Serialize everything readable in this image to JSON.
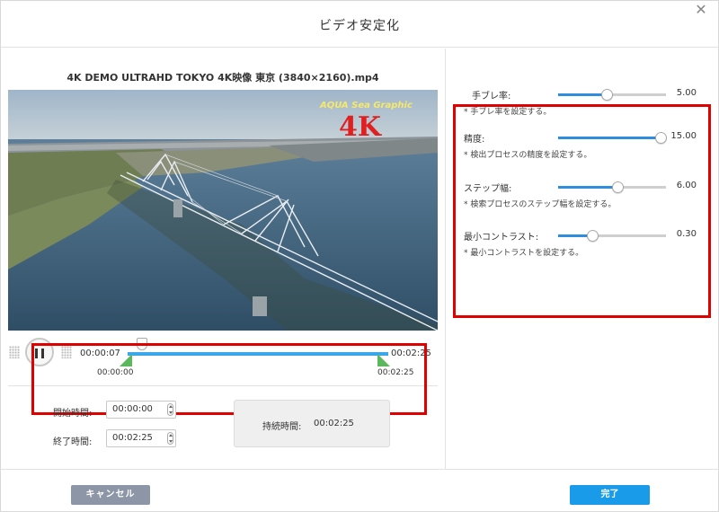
{
  "window": {
    "title": "ビデオ安定化"
  },
  "video": {
    "filename": "4K DEMO ULTRAHD TOKYO 4K映像 東京 (3840×2160).mp4",
    "watermark": "AQUA Sea Graphic",
    "badge": "4K"
  },
  "player": {
    "current_time": "00:00:07",
    "end_time_top": "00:02:25",
    "trim_start_label": "00:00:00",
    "trim_end_label": "00:02:25"
  },
  "trim": {
    "start_label": "開始時間:",
    "start_value": "00:00:00",
    "end_label": "終了時間:",
    "end_value": "00:02:25",
    "duration_label": "持続時間:",
    "duration_value": "00:02:25"
  },
  "settings": [
    {
      "label": "手ブレ率:",
      "value": "5.00",
      "level": 0.45,
      "description": "* 手ブレ率を設定する。"
    },
    {
      "label": "精度:",
      "value": "15.00",
      "level": 0.95,
      "description": "* 検出プロセスの精度を設定する。"
    },
    {
      "label": "ステップ幅:",
      "value": "6.00",
      "level": 0.55,
      "description": "* 検索プロセスのステップ幅を設定する。"
    },
    {
      "label": "最小コントラスト:",
      "value": "0.30",
      "level": 0.32,
      "description": "* 最小コントラストを設定する。"
    }
  ],
  "buttons": {
    "cancel": "キャンセル",
    "ok": "完了"
  },
  "icons": {
    "close": "close-icon",
    "pause": "pause-icon",
    "drag": "drag-handle-icon",
    "spinner": "spinner-icon"
  },
  "colors": {
    "accent": "#1a9bea",
    "highlight_border": "#e00000",
    "slider_fill": "#2f8de0",
    "trim_handle": "#5cb85c"
  }
}
